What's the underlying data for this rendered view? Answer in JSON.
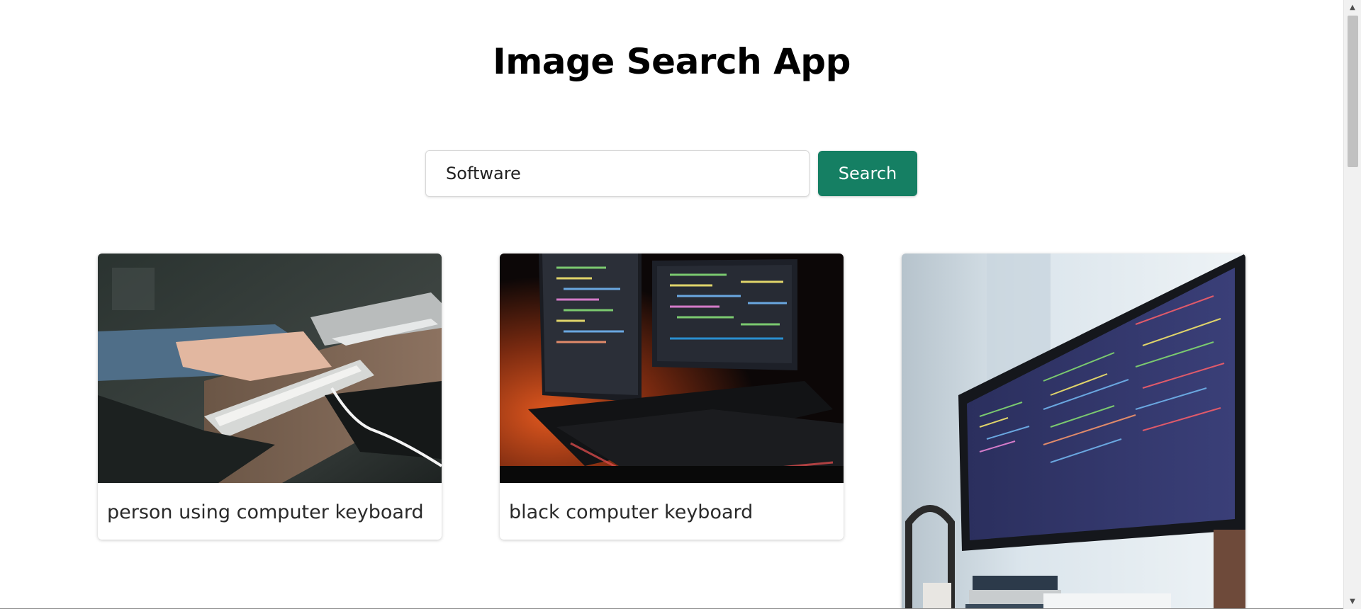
{
  "app": {
    "title": "Image Search App"
  },
  "search": {
    "value": "Software",
    "button_label": "Search"
  },
  "results": [
    {
      "caption": "person using computer keyboard",
      "image": "photo: hands typing on a white keyboard at a wooden desk"
    },
    {
      "caption": "black computer keyboard",
      "image": "photo: black keyboard in front of monitors displaying code with orange backlight"
    },
    {
      "caption": "",
      "image": "photo: curved monitor displaying code on a desk with headphones"
    }
  ],
  "colors": {
    "accent": "#157f63",
    "background": "#ffffff"
  },
  "icons": {
    "scroll_up": "triangle-up-icon",
    "scroll_down": "triangle-down-icon"
  }
}
